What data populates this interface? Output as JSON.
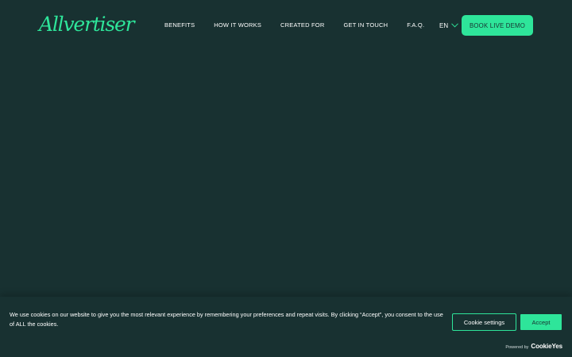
{
  "brand": {
    "logo_text": "Allvertiser",
    "accent_color": "#2ee59a",
    "background_color": "#183131"
  },
  "nav": {
    "items": [
      {
        "label": "BENEFITS"
      },
      {
        "label": "HOW IT WORKS"
      },
      {
        "label": "CREATED FOR"
      },
      {
        "label": "GET IN TOUCH"
      },
      {
        "label": "F.A.Q."
      }
    ],
    "language": "EN",
    "language_icon": "chevron-down-icon",
    "cta_label": "BOOK LIVE DEMO"
  },
  "cookie_banner": {
    "message": "We use cookies on our website to give you the most relevant experience by remembering your preferences and repeat visits. By clicking “Accept”, you consent to the use of ALL the cookies.",
    "settings_label": "Cookie settings",
    "accept_label": "Accept",
    "powered_by_label": "Powered by",
    "powered_by_brand": "CookieYes"
  }
}
